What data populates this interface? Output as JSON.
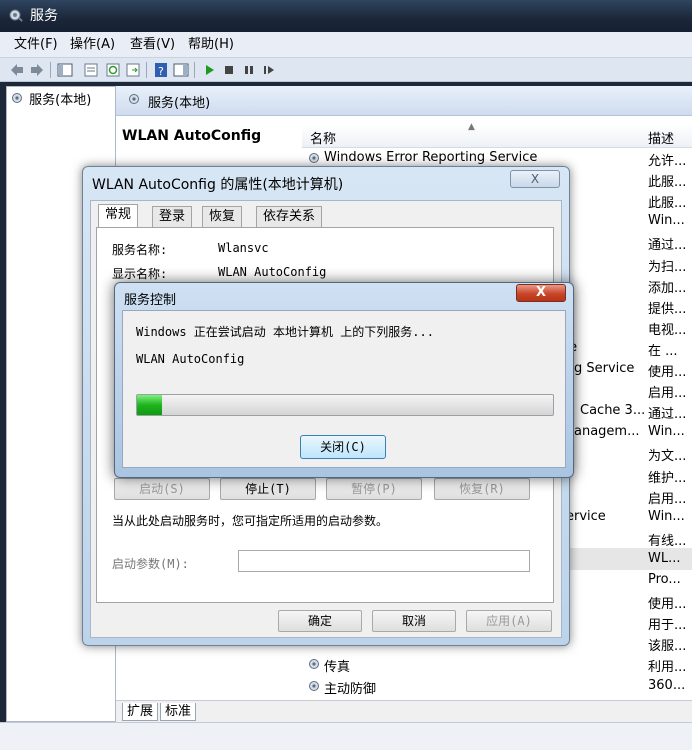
{
  "window": {
    "title": "服务"
  },
  "menu": [
    "文件(F)",
    "操作(A)",
    "查看(V)",
    "帮助(H)"
  ],
  "tree": {
    "root": "服务(本地)"
  },
  "panel": {
    "header": "服务(本地)",
    "selected_service": "WLAN AutoConfig"
  },
  "columns": {
    "name": "名称",
    "desc": "描述"
  },
  "rows": [
    {
      "name": "Windows Error Reporting Service",
      "desc": "允许..."
    },
    {
      "name": "",
      "desc": "此服..."
    },
    {
      "name": "",
      "desc": "此服..."
    },
    {
      "name": "",
      "desc": "Win..."
    },
    {
      "name": "",
      "desc": "通过..."
    },
    {
      "name": "",
      "desc": "为扫..."
    },
    {
      "name": "",
      "desc": "添加..."
    },
    {
      "name": "",
      "desc": "提供..."
    },
    {
      "name": "e",
      "desc": "电视..."
    },
    {
      "name": "ce",
      "desc": "在 ..."
    },
    {
      "name": "g Service",
      "desc": "使用..."
    },
    {
      "name": "",
      "desc": "启用..."
    },
    {
      "name": "Cache 3...",
      "desc": "通过..."
    },
    {
      "name": "anagem...",
      "desc": "Win..."
    },
    {
      "name": "",
      "desc": "为文..."
    },
    {
      "name": "",
      "desc": "维护..."
    },
    {
      "name": "",
      "desc": "启用..."
    },
    {
      "name": "ervice",
      "desc": "Win..."
    },
    {
      "name": "",
      "desc": "有线..."
    },
    {
      "name": "",
      "desc": "WL..."
    },
    {
      "name": "",
      "desc": "Pro..."
    },
    {
      "name": "",
      "desc": "使用..."
    },
    {
      "name": "",
      "desc": "用于..."
    },
    {
      "name": "",
      "desc": "该服..."
    },
    {
      "name": "传真",
      "desc": "利用..."
    },
    {
      "name": "主动防御",
      "desc": "360..."
    }
  ],
  "bottom_tabs": [
    "扩展",
    "标准"
  ],
  "props": {
    "title": "WLAN AutoConfig 的属性(本地计算机)",
    "close": "X",
    "tabs": [
      "常规",
      "登录",
      "恢复",
      "依存关系"
    ],
    "service_name_label": "服务名称:",
    "service_name": "Wlansvc",
    "display_name_label": "显示名称:",
    "display_name": "WLAN AutoConfig",
    "buttons": {
      "start": "启动(S)",
      "stop": "停止(T)",
      "pause": "暂停(P)",
      "resume": "恢复(R)"
    },
    "hint": "当从此处启动服务时，您可指定所适用的启动参数。",
    "param_label": "启动参数(M):",
    "param_value": "",
    "ok": "确定",
    "cancel": "取消",
    "apply": "应用(A)"
  },
  "svc_control": {
    "title": "服务控制",
    "close": "X",
    "message": "Windows 正在尝试启动 本地计算机 上的下列服务...",
    "service": "WLAN AutoConfig",
    "progress": 0.06,
    "close_button": "关闭(C)"
  },
  "colors": {
    "progress_green": "#1fb31f",
    "selection_gray": "#e6e6e6"
  }
}
